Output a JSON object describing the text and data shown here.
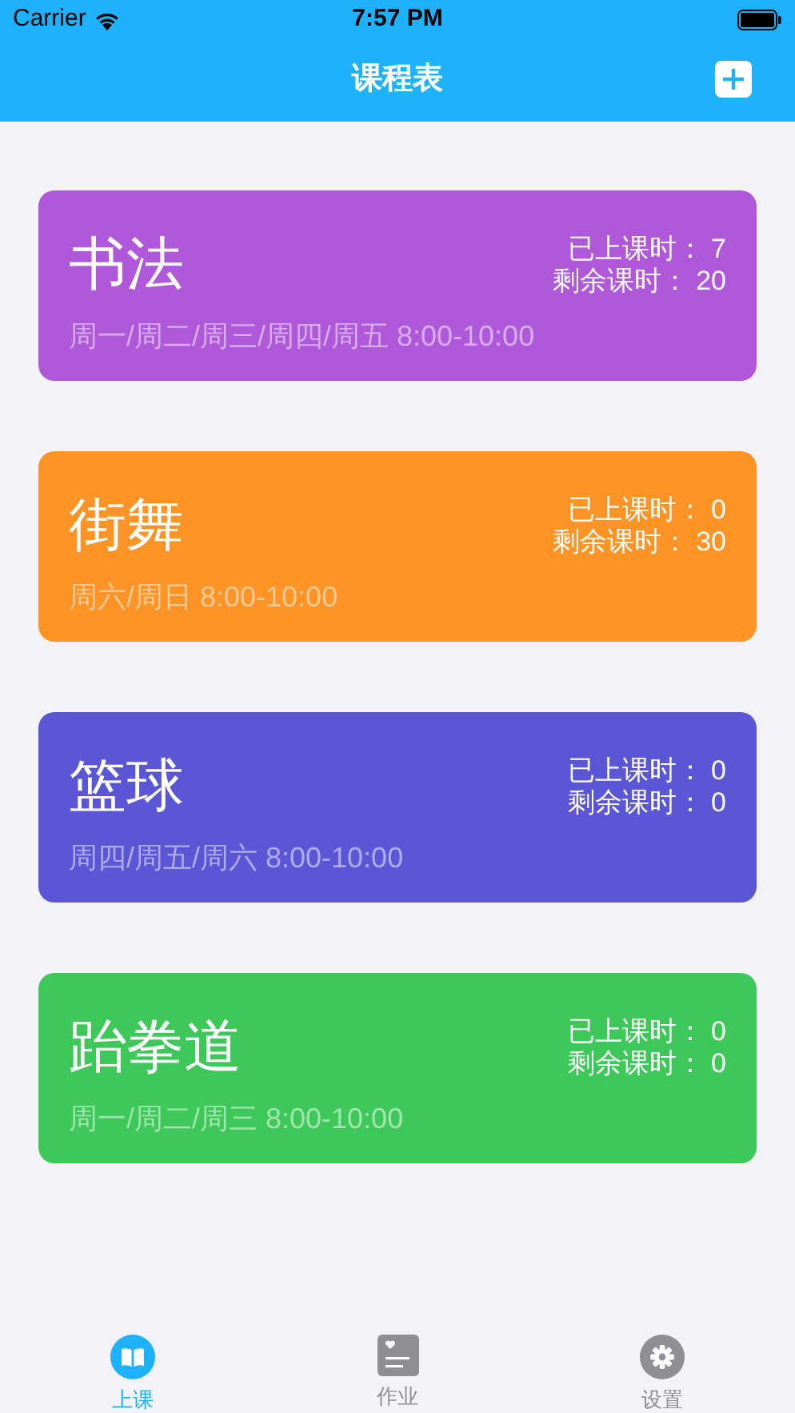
{
  "status_bar": {
    "carrier": "Carrier",
    "time": "7:57 PM"
  },
  "nav": {
    "title": "课程表"
  },
  "courses": [
    {
      "name": "书法",
      "attended_label": "已上课时：",
      "attended": "7",
      "remaining_label": "剩余课时：",
      "remaining": "20",
      "schedule": "周一/周二/周三/周四/周五 8:00-10:00",
      "color": "#af58da"
    },
    {
      "name": "街舞",
      "attended_label": "已上课时：",
      "attended": "0",
      "remaining_label": "剩余课时：",
      "remaining": "30",
      "schedule": "周六/周日 8:00-10:00",
      "color": "#ff9426"
    },
    {
      "name": "篮球",
      "attended_label": "已上课时：",
      "attended": "0",
      "remaining_label": "剩余课时：",
      "remaining": "0",
      "schedule": "周四/周五/周六 8:00-10:00",
      "color": "#5a56d6"
    },
    {
      "name": "跆拳道",
      "attended_label": "已上课时：",
      "attended": "0",
      "remaining_label": "剩余课时：",
      "remaining": "0",
      "schedule": "周一/周二/周三 8:00-10:00",
      "color": "#3ec85a"
    }
  ],
  "tabs": [
    {
      "label": "上课",
      "kind": "book",
      "selected": true
    },
    {
      "label": "作业",
      "kind": "note",
      "selected": false
    },
    {
      "label": "设置",
      "kind": "gear",
      "selected": false
    }
  ]
}
